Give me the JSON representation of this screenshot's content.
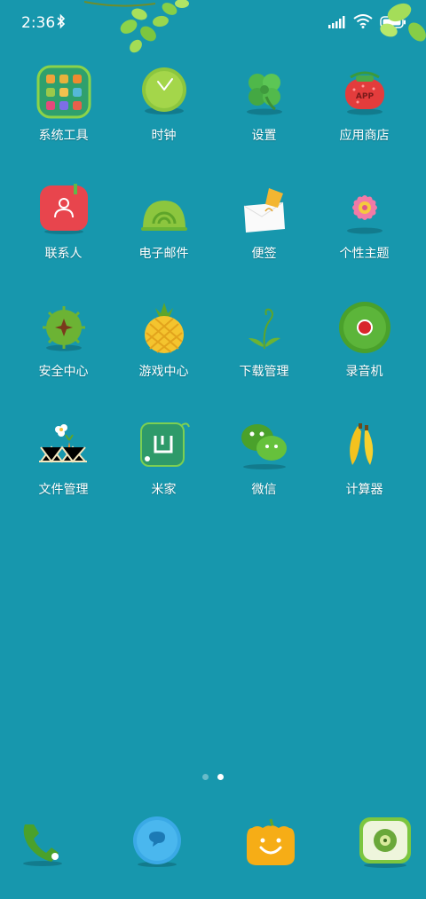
{
  "status_bar": {
    "time": "2:36",
    "battery_level": 1.0
  },
  "page_indicator": {
    "pages": 2,
    "current": 2
  },
  "apps": [
    {
      "label": "系统工具",
      "icon": "folder-icon"
    },
    {
      "label": "时钟",
      "icon": "clock-icon"
    },
    {
      "label": "设置",
      "icon": "clover-settings-icon"
    },
    {
      "label": "应用商店",
      "icon": "strawberry-app-store-icon"
    },
    {
      "label": "联系人",
      "icon": "contacts-icon"
    },
    {
      "label": "电子邮件",
      "icon": "snail-email-icon"
    },
    {
      "label": "便签",
      "icon": "notes-icon"
    },
    {
      "label": "个性主题",
      "icon": "flower-themes-icon"
    },
    {
      "label": "安全中心",
      "icon": "chestnut-security-icon"
    },
    {
      "label": "游戏中心",
      "icon": "pineapple-games-icon"
    },
    {
      "label": "下载管理",
      "icon": "sprout-download-icon"
    },
    {
      "label": "录音机",
      "icon": "record-icon"
    },
    {
      "label": "文件管理",
      "icon": "fence-files-icon"
    },
    {
      "label": "米家",
      "icon": "mijia-icon"
    },
    {
      "label": "微信",
      "icon": "wechat-icon"
    },
    {
      "label": "计算器",
      "icon": "banana-calculator-icon"
    }
  ],
  "folder_mini_icons": [
    "#f2a33a",
    "#e8b23c",
    "#f08a2f",
    "#9bc94a",
    "#f2c14e",
    "#55b8d8",
    "#e5497b",
    "#7d6ee6",
    "#e8604b"
  ],
  "dock": [
    {
      "icon": "phone-icon"
    },
    {
      "icon": "messages-icon"
    },
    {
      "icon": "pumpkin-browser-icon"
    },
    {
      "icon": "kiwi-camera-icon"
    }
  ]
}
